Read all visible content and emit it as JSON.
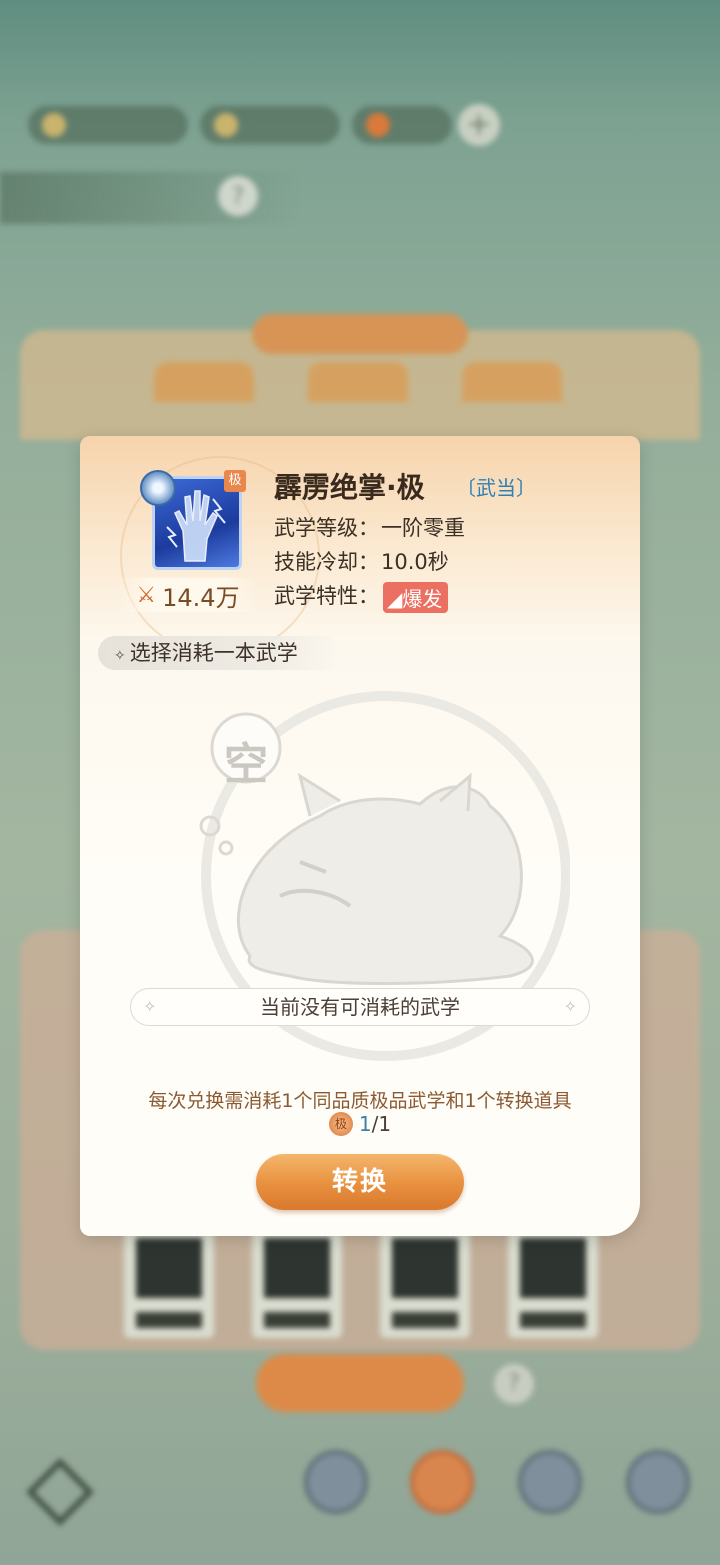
{
  "skill": {
    "name": "霹雳绝掌·极",
    "school": "〔武当〕",
    "tier_badge": "极",
    "power": "14.4万",
    "power_icon": "crossed-swords-icon",
    "level_label": "武学等级：",
    "level_value": "一阶零重",
    "cooldown_label": "技能冷却：",
    "cooldown_value": "10.0秒",
    "trait_label": "武学特性：",
    "trait_value": "爆发"
  },
  "consume_section": {
    "title": "选择消耗一本武学",
    "empty_badge": "空",
    "empty_text": "当前没有可消耗的武学"
  },
  "footer": {
    "rule_text": "每次兑换需消耗1个同品质极品武学和1个转换道具",
    "cost_icon_label": "极",
    "cost_have": "1",
    "cost_sep": "/",
    "cost_need": "1",
    "convert_button": "转换"
  },
  "colors": {
    "accent_orange": "#e8903e",
    "school_blue": "#2e7fb6",
    "trait_red": "#ec7061",
    "rule_brown": "#8c5a32"
  }
}
